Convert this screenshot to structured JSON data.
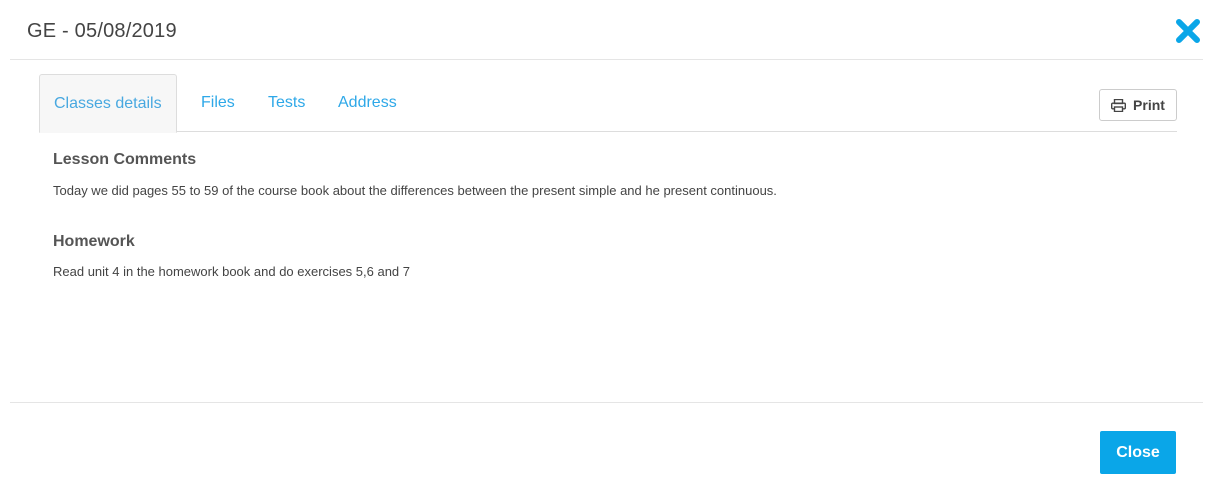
{
  "header": {
    "title": "GE - 05/08/2019",
    "close_icon": "close-x-icon",
    "accent_color": "#0aa6e8"
  },
  "tabs": [
    {
      "label": "Classes details",
      "active": true
    },
    {
      "label": "Files",
      "active": false
    },
    {
      "label": "Tests",
      "active": false
    },
    {
      "label": "Address",
      "active": false
    }
  ],
  "toolbar": {
    "print_label": "Print",
    "print_icon": "printer-icon"
  },
  "content": {
    "lesson_comments": {
      "title": "Lesson Comments",
      "text": "Today we did pages 55 to 59 of the course book about the differences between the present simple and he present continuous."
    },
    "homework": {
      "title": "Homework",
      "text": "Read unit 4 in the homework book and do exercises 5,6 and 7"
    }
  },
  "footer": {
    "close_label": "Close"
  }
}
